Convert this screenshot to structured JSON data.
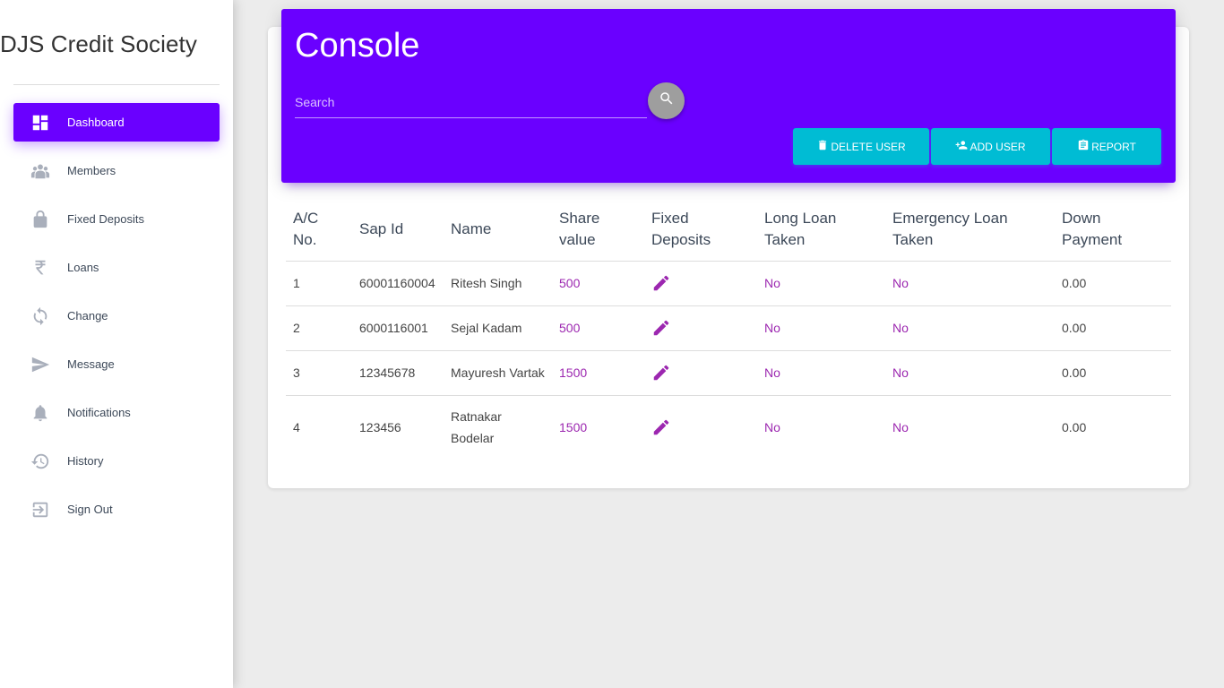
{
  "brand": "DJS Credit Society",
  "nav": [
    {
      "label": "Dashboard",
      "icon": "dashboard-icon",
      "active": true
    },
    {
      "label": "Members",
      "icon": "people-icon"
    },
    {
      "label": "Fixed Deposits",
      "icon": "lock-icon"
    },
    {
      "label": "Loans",
      "icon": "rupee-icon"
    },
    {
      "label": "Change",
      "icon": "refresh-icon"
    },
    {
      "label": "Message",
      "icon": "send-icon"
    },
    {
      "label": "Notifications",
      "icon": "bell-icon"
    },
    {
      "label": "History",
      "icon": "history-icon"
    },
    {
      "label": "Sign Out",
      "icon": "sign-out-icon"
    }
  ],
  "header": {
    "title": "Console",
    "search_placeholder": "Search",
    "delete_label": "DELETE USER",
    "add_label": "ADD USER",
    "report_label": "REPORT"
  },
  "table": {
    "columns": [
      "A/C No.",
      "Sap Id",
      "Name",
      "Share value",
      "Fixed Deposits",
      "Long Loan Taken",
      "Emergency Loan Taken",
      "Down Payment"
    ],
    "rows": [
      {
        "ac": "1",
        "sap": "60001160004",
        "name": "Ritesh Singh",
        "share": "500",
        "long": "No",
        "emergency": "No",
        "down": "0.00"
      },
      {
        "ac": "2",
        "sap": "6000116001",
        "name": "Sejal Kadam",
        "share": "500",
        "long": "No",
        "emergency": "No",
        "down": "0.00"
      },
      {
        "ac": "3",
        "sap": "12345678",
        "name": "Mayuresh Vartak",
        "share": "1500",
        "long": "No",
        "emergency": "No",
        "down": "0.00"
      },
      {
        "ac": "4",
        "sap": "123456",
        "name": "Ratnakar Bodelar",
        "share": "1500",
        "long": "No",
        "emergency": "No",
        "down": "0.00"
      }
    ]
  },
  "colors": {
    "primary": "#6a00ff",
    "accent": "#00bcd4",
    "link": "#9c27b0",
    "search_button": "#9e9e9e"
  }
}
